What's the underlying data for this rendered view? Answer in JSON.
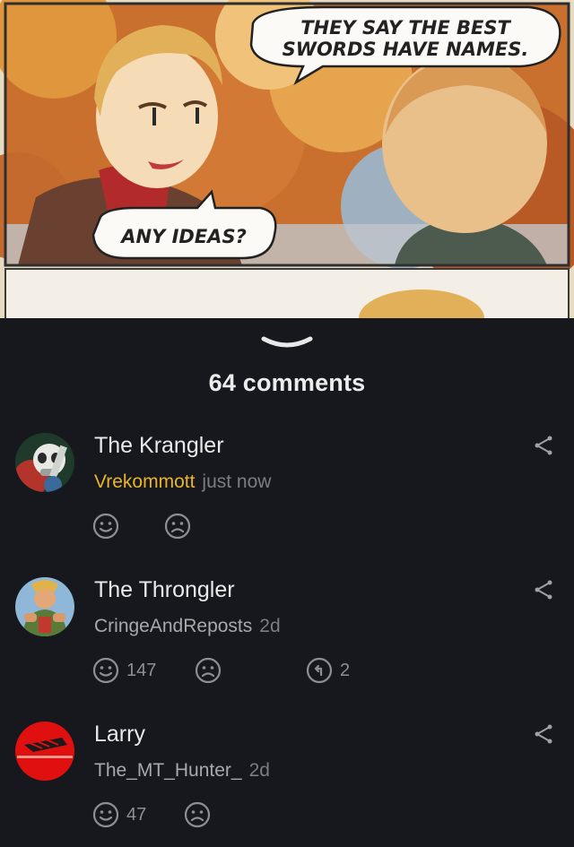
{
  "comic": {
    "bubble_top": [
      "THEY SAY THE BEST",
      "SWORDS HAVE NAMES."
    ],
    "bubble_bottom": "ANY IDEAS?"
  },
  "comments": {
    "count_label": "64 comments",
    "items": [
      {
        "title": "The Krangler",
        "user": "Vrekommott",
        "time": "just now",
        "upvotes": "",
        "replies": ""
      },
      {
        "title": "The Throngler",
        "user": "CringeAndReposts",
        "time": "2d",
        "upvotes": "147",
        "replies": "2"
      },
      {
        "title": "Larry",
        "user": "The_MT_Hunter_",
        "time": "2d",
        "upvotes": "47",
        "replies": ""
      }
    ]
  },
  "icons": {
    "collapse": "chevron-down-icon",
    "share": "share-icon",
    "upvote": "smile-icon",
    "downvote": "frown-icon",
    "reply": "reply-icon"
  },
  "colors": {
    "background": "#17181d",
    "op_username": "#e8b52c"
  }
}
